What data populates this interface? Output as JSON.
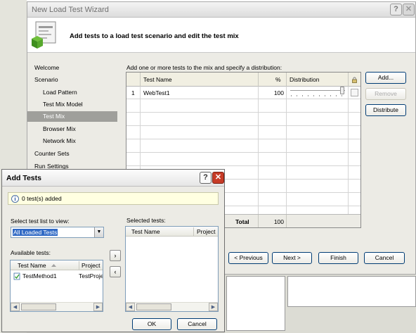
{
  "wizard": {
    "title": "New Load Test Wizard",
    "header_text": "Add tests to a load test scenario and edit the test mix",
    "description": "Add one or more tests to the mix and specify a distribution:",
    "nav": [
      {
        "label": "Welcome",
        "level": 1
      },
      {
        "label": "Scenario",
        "level": 1
      },
      {
        "label": "Load Pattern",
        "level": 2
      },
      {
        "label": "Test Mix Model",
        "level": 2
      },
      {
        "label": "Test Mix",
        "level": 2,
        "selected": true
      },
      {
        "label": "Browser Mix",
        "level": 2
      },
      {
        "label": "Network Mix",
        "level": 2
      },
      {
        "label": "Counter Sets",
        "level": 1
      },
      {
        "label": "Run Settings",
        "level": 1
      }
    ],
    "grid": {
      "col_test_name": "Test Name",
      "col_percent": "%",
      "col_distribution": "Distribution",
      "rows": [
        {
          "num": "1",
          "name": "WebTest1",
          "percent": "100"
        }
      ],
      "total_label": "Total",
      "total_value": "100"
    },
    "buttons": {
      "add": "Add...",
      "remove": "Remove",
      "distribute": "Distribute",
      "previous": "< Previous",
      "next": "Next >",
      "finish": "Finish",
      "cancel": "Cancel"
    }
  },
  "dialog": {
    "title": "Add Tests",
    "info": "0 test(s) added",
    "select_list_label": "Select test list to view:",
    "select_list_value": "All Loaded Tests",
    "available_label": "Available tests:",
    "available_col_name": "Test Name",
    "available_col_project": "Project",
    "available_items": [
      {
        "name": "TestMethod1",
        "project": "TestProject"
      }
    ],
    "selected_label": "Selected tests:",
    "selected_col_name": "Test Name",
    "selected_col_project": "Project",
    "ok": "OK",
    "cancel": "Cancel"
  },
  "colors": {
    "xp_button_border": "#003c74",
    "selection": "#316ac5",
    "nav_selected": "#9f9f9b",
    "info_bar": "#ffffe1",
    "close_red": "#c73b26"
  },
  "icons": [
    "help-icon",
    "close-icon",
    "wizard-icon",
    "info-icon",
    "sort-arrow-icon",
    "test-method-icon",
    "chevron-down-icon",
    "arrow-right-icon",
    "arrow-left-icon"
  ]
}
